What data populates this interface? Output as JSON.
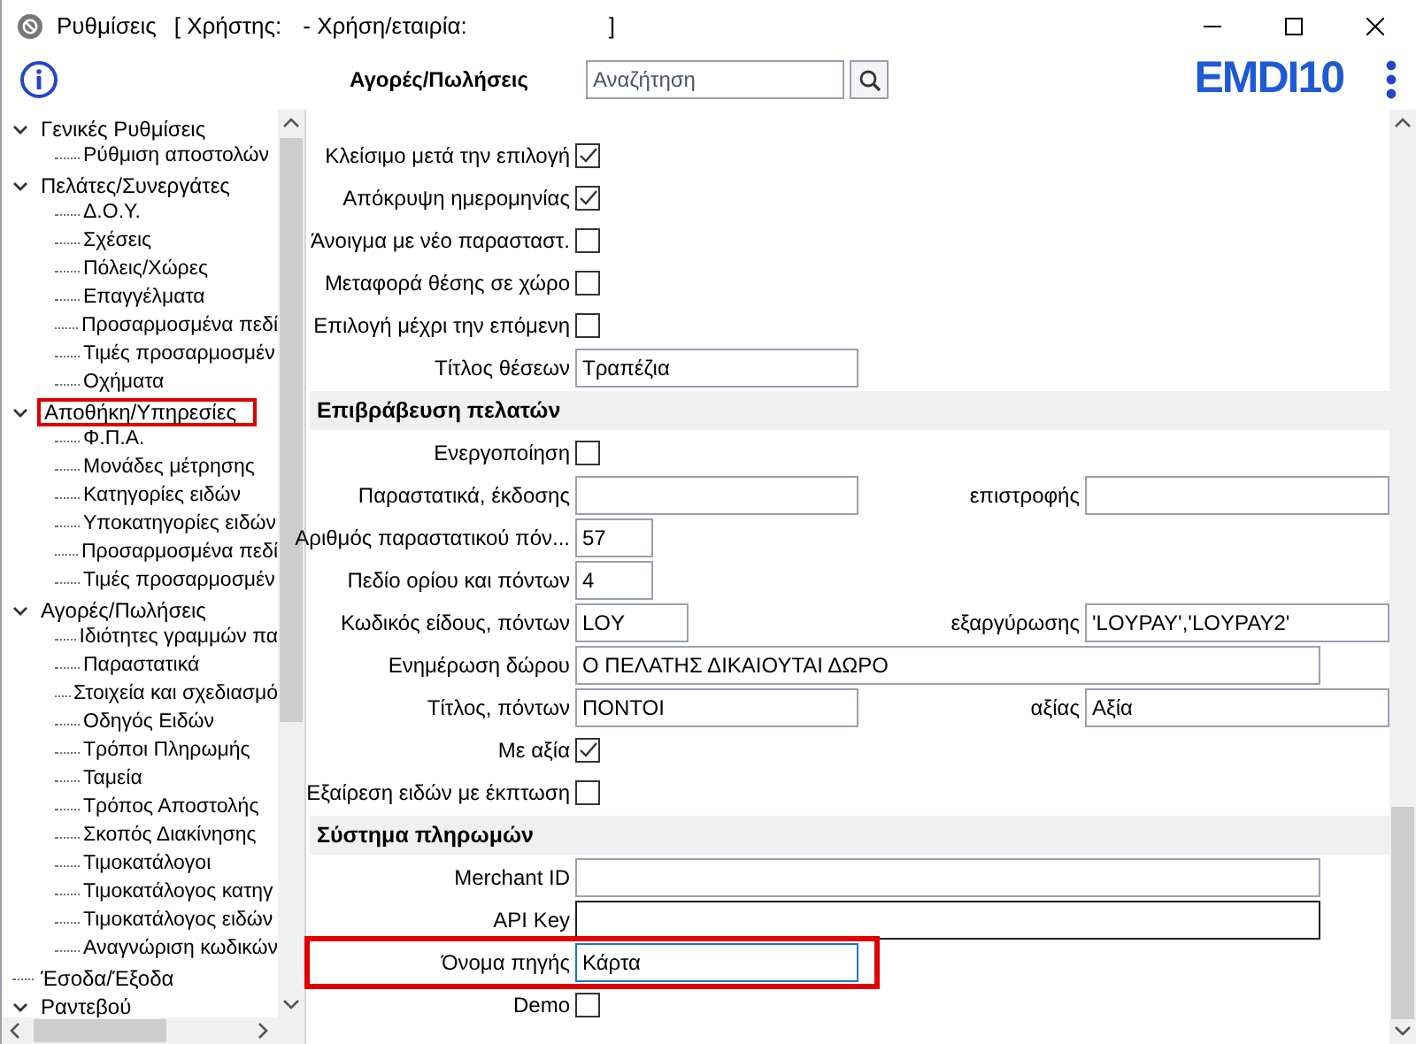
{
  "window": {
    "title": "Ρυθμίσεις",
    "user_label": "[ Χρήστης:",
    "company_label": "- Χρήση/εταιρία:",
    "bracket_close": "]"
  },
  "toolbar": {
    "section_title": "Αγορές/Πωλήσεις",
    "search": {
      "placeholder": "Αναζήτηση"
    },
    "logo": "EMDI10"
  },
  "tree": [
    {
      "label": "Γενικές Ρυθμίσεις",
      "expanded": true,
      "highlighted": false,
      "children": [
        {
          "label": "Ρύθμιση αποστολών"
        }
      ]
    },
    {
      "label": "Πελάτες/Συνεργάτες",
      "expanded": true,
      "highlighted": false,
      "children": [
        {
          "label": "Δ.Ο.Υ."
        },
        {
          "label": "Σχέσεις"
        },
        {
          "label": "Πόλεις/Χώρες"
        },
        {
          "label": "Επαγγέλματα"
        },
        {
          "label": "Προσαρμοσμένα πεδί"
        },
        {
          "label": "Τιμές προσαρμοσμέν"
        },
        {
          "label": "Οχήματα"
        }
      ]
    },
    {
      "label": "Αποθήκη/Υπηρεσίες",
      "expanded": true,
      "highlighted": true,
      "children": [
        {
          "label": "Φ.Π.Α."
        },
        {
          "label": "Μονάδες μέτρησης"
        },
        {
          "label": "Κατηγορίες ειδών"
        },
        {
          "label": "Υποκατηγορίες ειδών"
        },
        {
          "label": "Προσαρμοσμένα πεδί"
        },
        {
          "label": "Τιμές προσαρμοσμέν"
        }
      ]
    },
    {
      "label": "Αγορές/Πωλήσεις",
      "expanded": true,
      "highlighted": false,
      "children": [
        {
          "label": "Ιδιότητες γραμμών πα"
        },
        {
          "label": "Παραστατικά"
        },
        {
          "label": "Στοιχεία και σχεδιασμό"
        },
        {
          "label": "Οδηγός Ειδών"
        },
        {
          "label": "Τρόποι Πληρωμής"
        },
        {
          "label": "Ταμεία"
        },
        {
          "label": "Τρόπος Αποστολής"
        },
        {
          "label": "Σκοπός Διακίνησης"
        },
        {
          "label": "Τιμοκατάλογοι"
        },
        {
          "label": "Τιμοκατάλογος κατηγ"
        },
        {
          "label": "Τιμοκατάλογος ειδών"
        },
        {
          "label": "Αναγνώριση κωδικών"
        }
      ]
    },
    {
      "label": "Έσοδα/Έξοδα",
      "highlighted": false
    },
    {
      "label": "Ραντεβού",
      "expanded": true,
      "highlighted": false
    }
  ],
  "form": [
    {
      "kind": "checkbox",
      "label": "Κλείσιμο μετά την επιλογή",
      "checked": true
    },
    {
      "kind": "checkbox",
      "label": "Απόκρυψη ημερομηνίας",
      "checked": true
    },
    {
      "kind": "checkbox",
      "label": "Άνοιγμα με νέο παρασταστ.",
      "checked": false
    },
    {
      "kind": "checkbox",
      "label": "Μεταφορά θέσης σε χώρο",
      "checked": false
    },
    {
      "kind": "checkbox",
      "label": "Επιλογή μέχρι την επόμενη",
      "checked": false
    },
    {
      "kind": "field",
      "label": "Τίτλος θέσεων",
      "value": "Τραπέζια"
    },
    {
      "kind": "section",
      "label": "Επιβράβευση πελατών"
    },
    {
      "kind": "checkbox",
      "label": "Ενεργοποίηση",
      "checked": false
    },
    {
      "kind": "pair",
      "label": "Παραστατικά, έκδοσης",
      "label2": "επιστροφής"
    },
    {
      "kind": "field",
      "label": "Αριθμός παραστατικού πόν...",
      "value": "57"
    },
    {
      "kind": "field",
      "label": "Πεδίο ορίου και πόντων",
      "value": "4"
    },
    {
      "kind": "pair",
      "label": "Κωδικός είδους, πόντων",
      "value": "LOY",
      "label2": "εξαργύρωσης",
      "value2": "'LOYPAY','LOYPAY2'"
    },
    {
      "kind": "field",
      "label": "Ενημέρωση δώρου",
      "value": "Ο ΠΕΛΑΤΗΣ ΔΙΚΑΙΟΥΤΑΙ ΔΩΡΟ"
    },
    {
      "kind": "pair",
      "label": "Τίτλος, πόντων",
      "value": "ΠΟΝΤΟΙ",
      "label2": "αξίας",
      "value2": "Αξία"
    },
    {
      "kind": "checkbox",
      "label": "Με αξία",
      "checked": true
    },
    {
      "kind": "checkbox",
      "label": "Εξαίρεση ειδών με έκπτωση",
      "checked": false
    },
    {
      "kind": "section",
      "label": "Σύστημα πληρωμών"
    },
    {
      "kind": "field",
      "label": "Merchant ID"
    },
    {
      "kind": "field",
      "label": "API Key",
      "focused": false,
      "dark": true
    },
    {
      "kind": "field",
      "label": "Όνομα πηγής",
      "value": "Κάρτα",
      "focused": true,
      "highlighted": true
    },
    {
      "kind": "checkbox",
      "label": "Demo",
      "checked": false
    }
  ]
}
